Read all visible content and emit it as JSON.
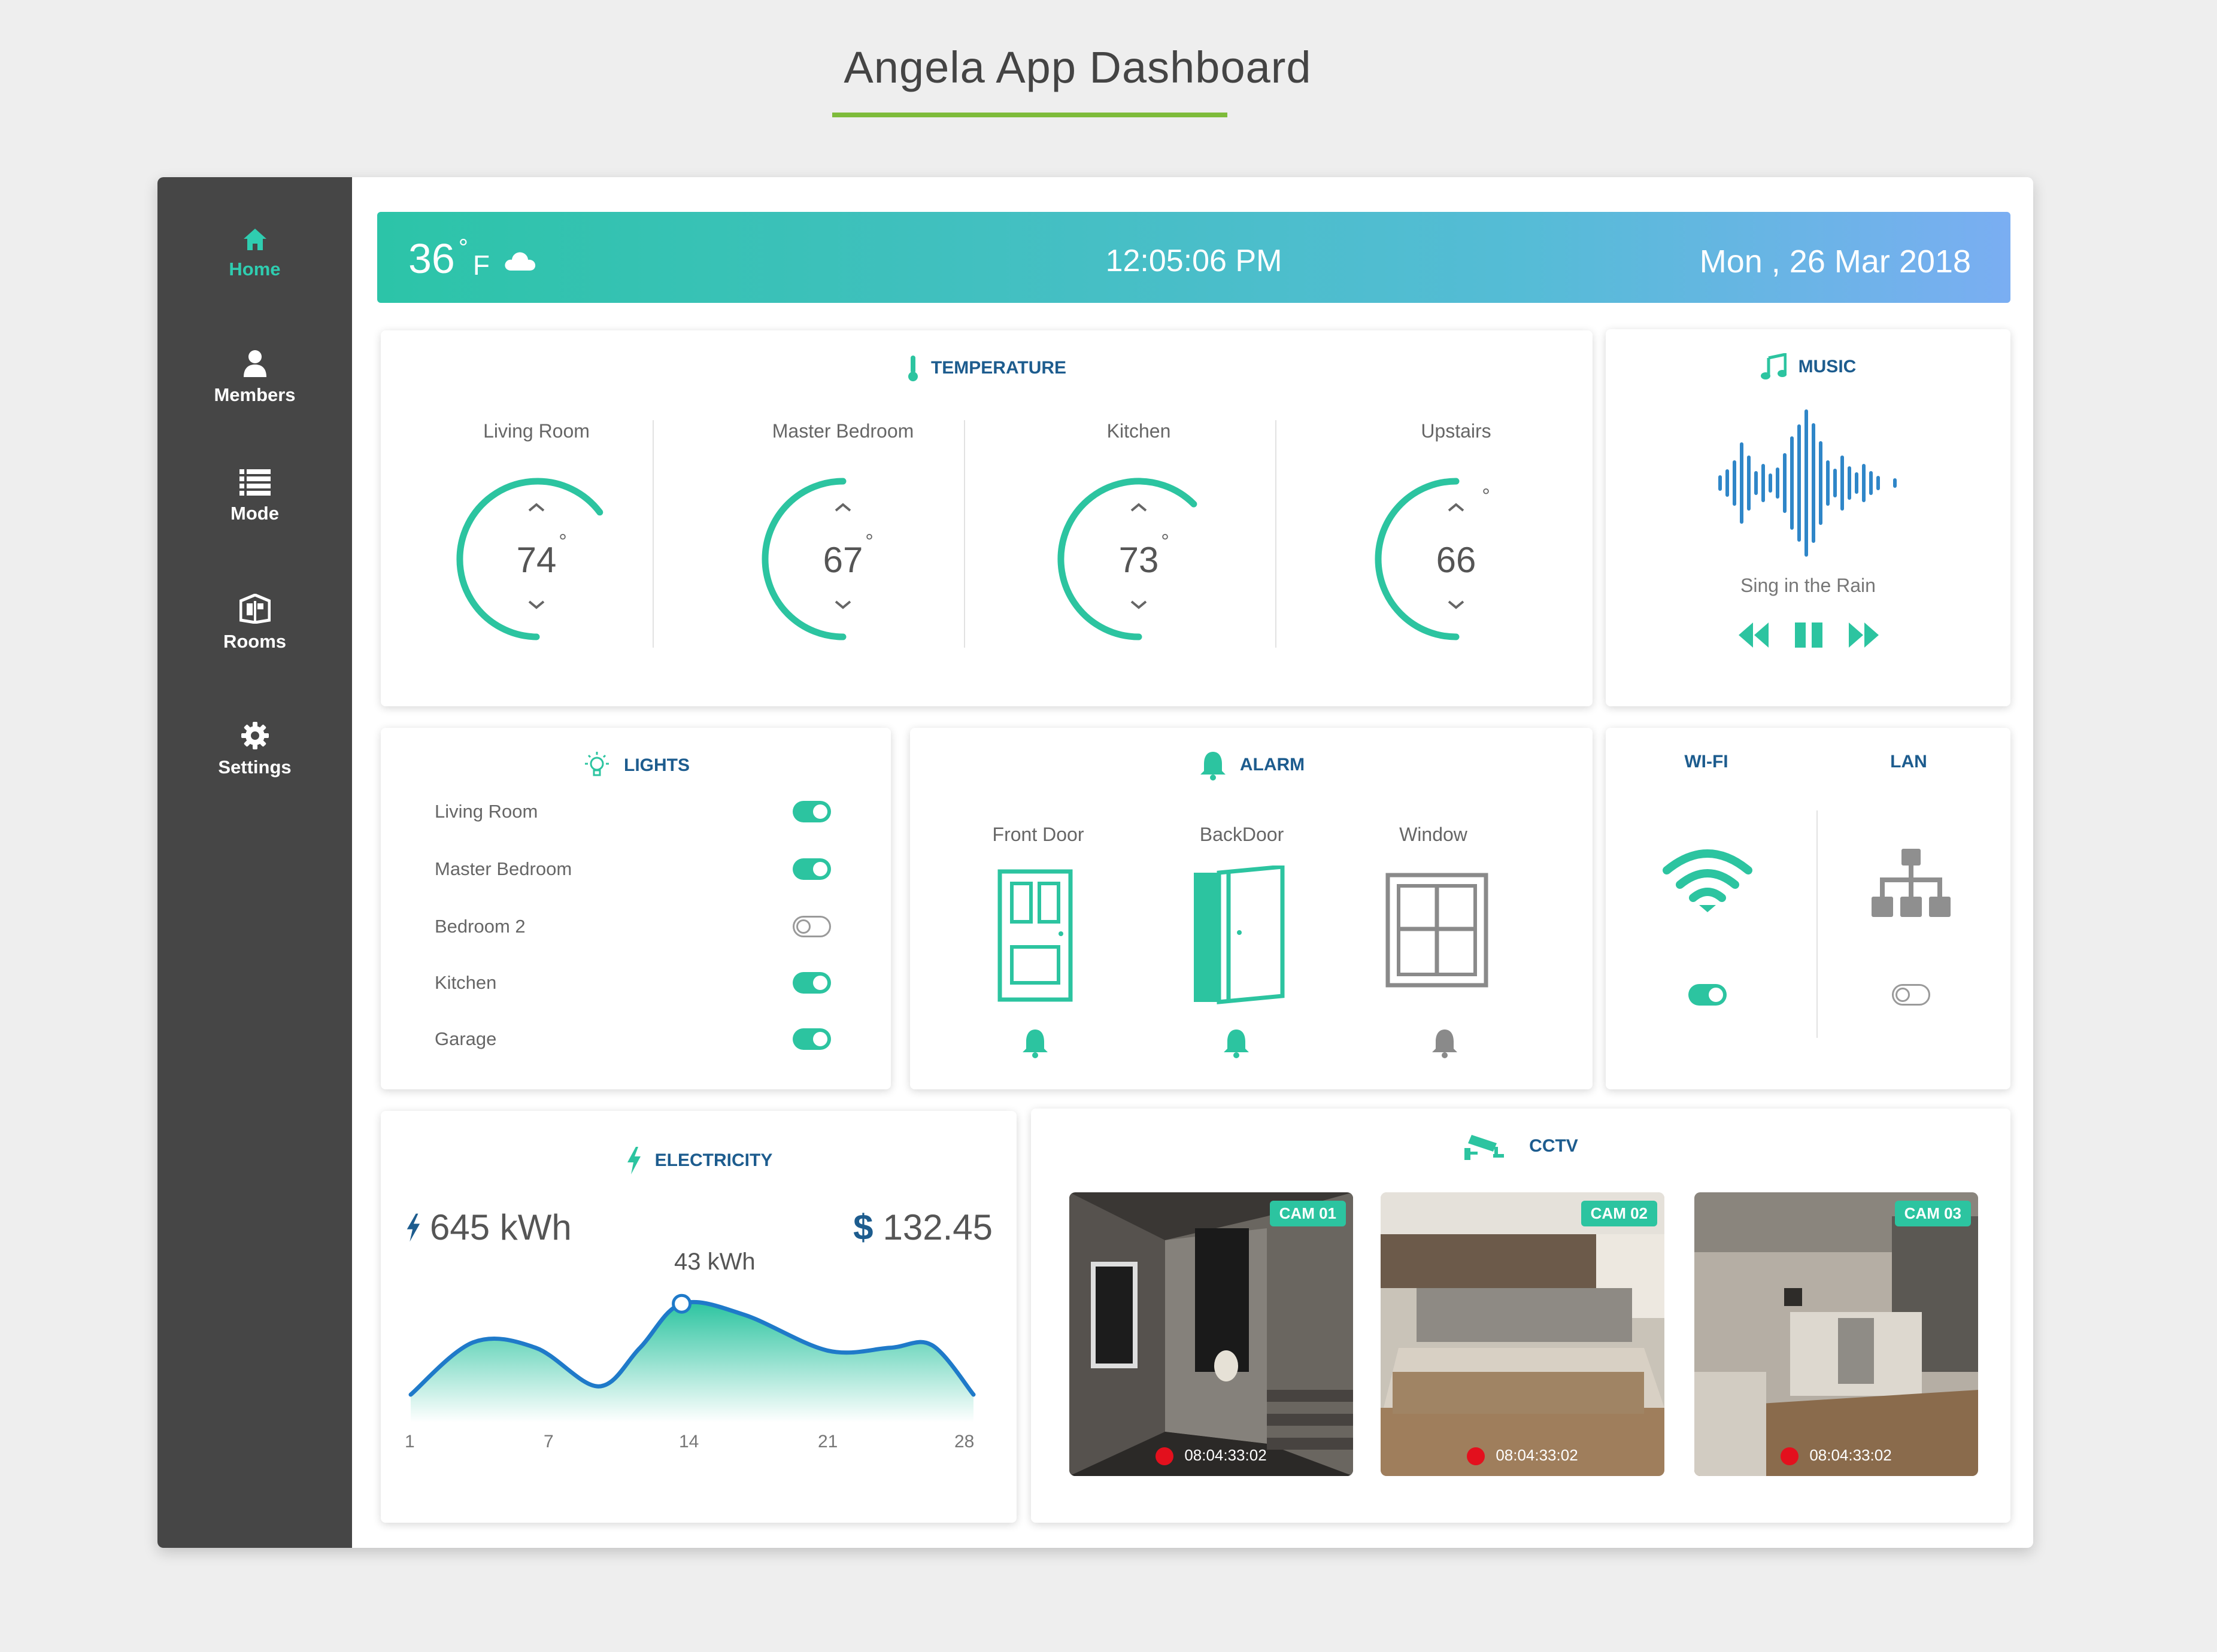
{
  "page": {
    "title": "Angela App Dashboard"
  },
  "sidebar": {
    "items": [
      {
        "label": "Home",
        "icon": "home-icon",
        "active": true
      },
      {
        "label": "Members",
        "icon": "user-icon"
      },
      {
        "label": "Mode",
        "icon": "list-icon"
      },
      {
        "label": "Rooms",
        "icon": "rooms-icon"
      },
      {
        "label": "Settings",
        "icon": "gear-icon"
      }
    ]
  },
  "topbar": {
    "temperature": "36",
    "degree": "°",
    "unit": "F",
    "weather_icon": "cloud-icon",
    "time": "12:05:06 PM",
    "date": "Mon , 26 Mar 2018"
  },
  "temperature": {
    "title": "TEMPERATURE",
    "zones": [
      {
        "name": "Living Room",
        "value": "74",
        "degree": "°"
      },
      {
        "name": "Master Bedroom",
        "value": "67",
        "degree": "°"
      },
      {
        "name": "Kitchen",
        "value": "73",
        "degree": "°"
      },
      {
        "name": "Upstairs",
        "value": "66",
        "degree": "°"
      }
    ]
  },
  "music": {
    "title": "MUSIC",
    "song": "Sing in the Rain"
  },
  "lights": {
    "title": "LIGHTS",
    "items": [
      {
        "label": "Living Room",
        "on": true
      },
      {
        "label": "Master Bedroom",
        "on": true
      },
      {
        "label": "Bedroom 2",
        "on": false
      },
      {
        "label": "Kitchen",
        "on": true
      },
      {
        "label": "Garage",
        "on": true
      }
    ]
  },
  "alarm": {
    "title": "ALARM",
    "items": [
      {
        "label": "Front Door",
        "armed": true
      },
      {
        "label": "BackDoor",
        "armed": true
      },
      {
        "label": "Window",
        "armed": false
      }
    ]
  },
  "network": {
    "wifi": {
      "label": "WI-FI",
      "on": true
    },
    "lan": {
      "label": "LAN",
      "on": false
    }
  },
  "electricity": {
    "title": "ELECTRICITY",
    "usage": "645 kWh",
    "cost_symbol": "$",
    "cost": "132.45",
    "peak_label": "43 kWh"
  },
  "cctv": {
    "title": "CCTV",
    "cameras": [
      {
        "label": "CAM 01",
        "time": "08:04:33:02"
      },
      {
        "label": "CAM 02",
        "time": "08:04:33:02"
      },
      {
        "label": "CAM 03",
        "time": "08:04:33:02"
      }
    ]
  },
  "colors": {
    "accent": "#2cc4a0",
    "heading": "#1d5c8e",
    "sidebar": "#464646",
    "brand_underline": "#7dbb3a",
    "music_wave": "#2f86c8"
  },
  "chart_data": {
    "type": "area",
    "x": [
      1,
      4,
      7,
      10,
      12,
      14,
      17,
      21,
      24,
      26,
      28
    ],
    "values": [
      10,
      29,
      27,
      13,
      27,
      43,
      39,
      26,
      27,
      28,
      10
    ],
    "xticks": [
      "1",
      "7",
      "14",
      "21",
      "28"
    ],
    "highlight": {
      "x": 14,
      "label": "43 kWh"
    },
    "ylim": [
      0,
      50
    ]
  }
}
